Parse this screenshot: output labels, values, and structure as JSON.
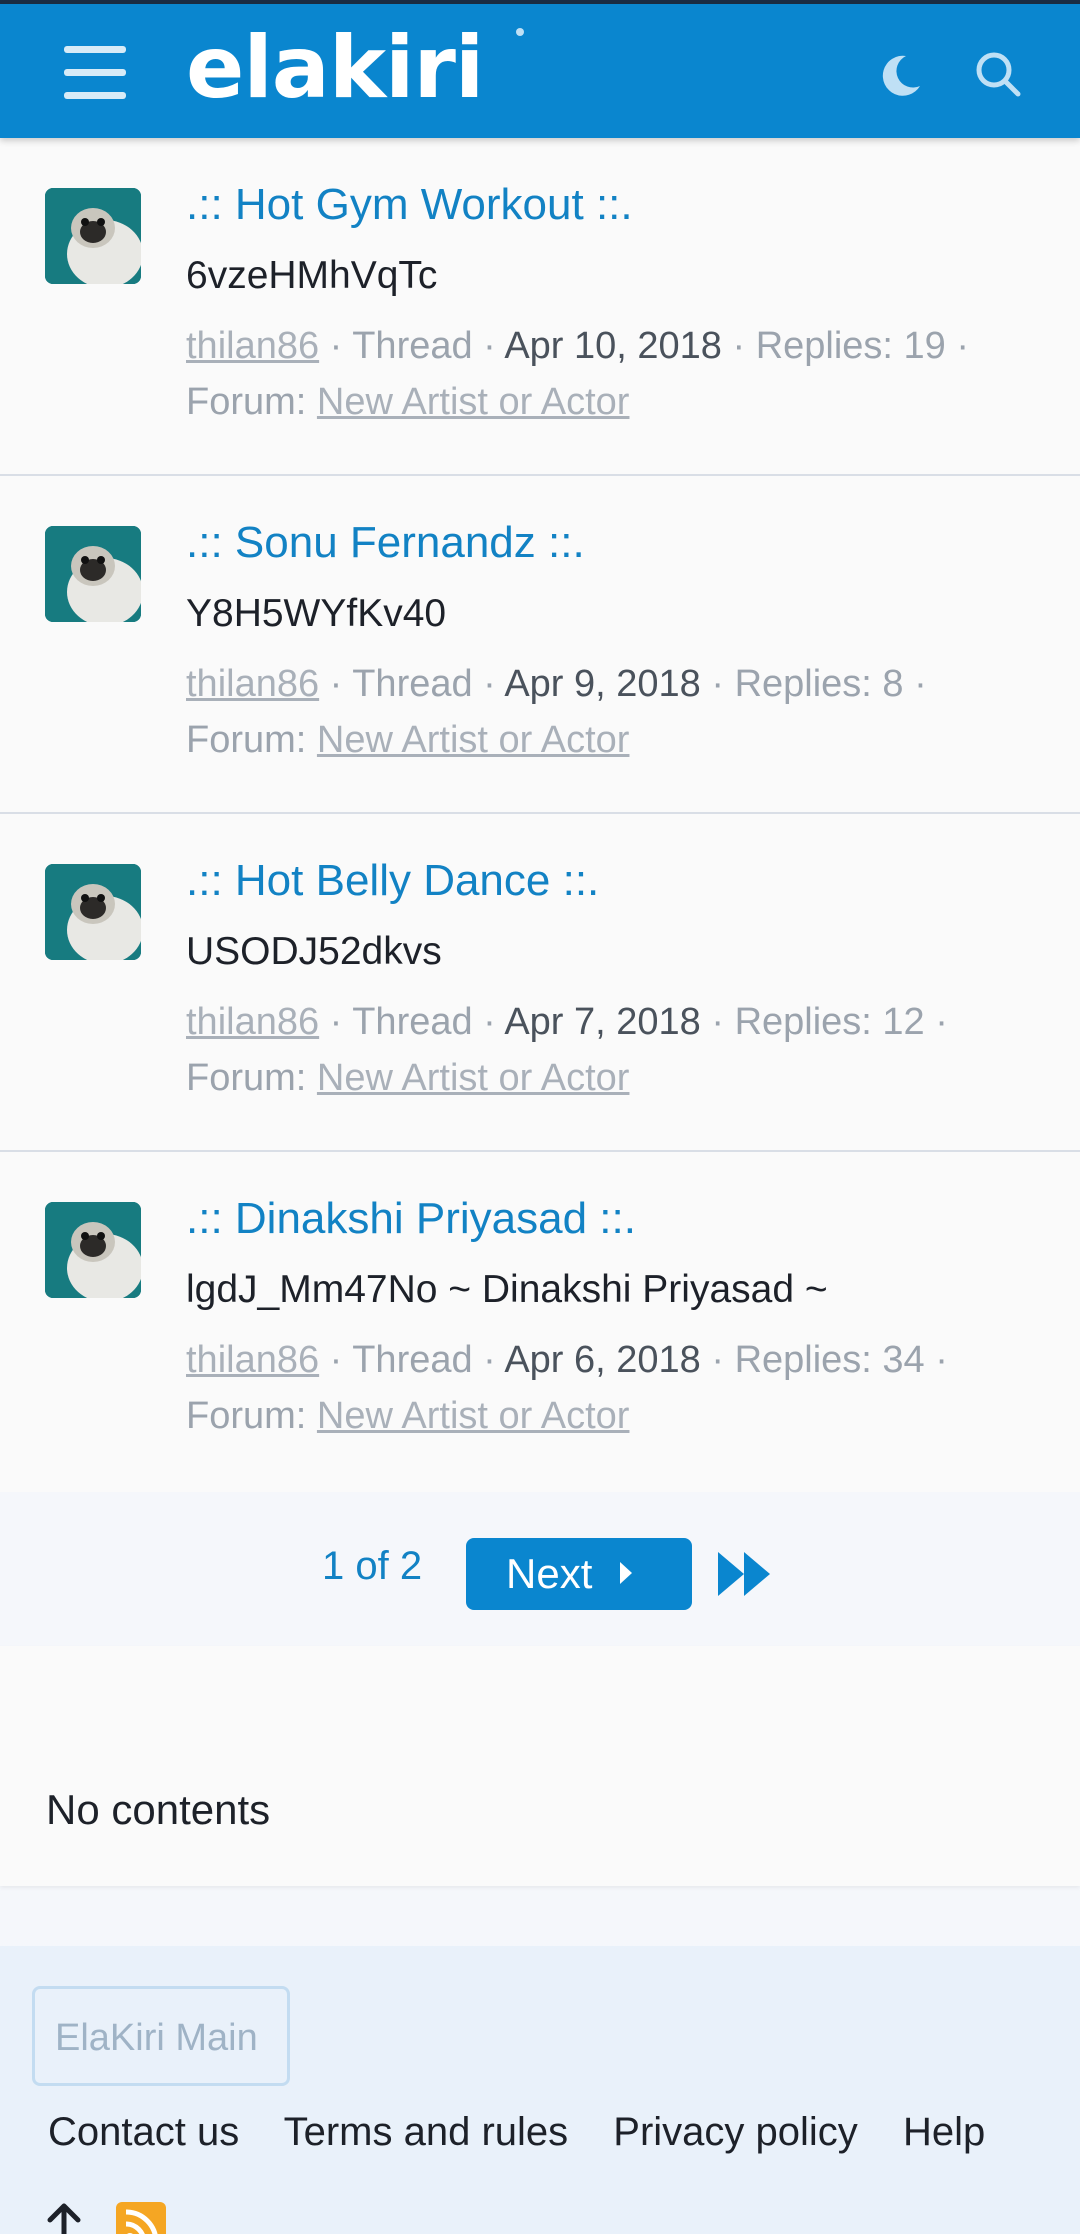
{
  "header": {
    "logo": "elakiri",
    "icons": [
      "hamburger-menu-icon",
      "moon-icon",
      "search-icon"
    ],
    "color": "#0a86cf"
  },
  "threads": [
    {
      "title": ".:: Hot Gym Workout ::.",
      "snippet": "6vzeHMhVqTc",
      "author": "thilan86",
      "type": "Thread",
      "date": "Apr 10, 2018",
      "replies": "Replies: 19",
      "forum_label": "Forum:",
      "forum": "New Artist or Actor"
    },
    {
      "title": ".:: Sonu Fernandz ::.",
      "snippet": "Y8H5WYfKv40",
      "author": "thilan86",
      "type": "Thread",
      "date": "Apr 9, 2018",
      "replies": "Replies: 8",
      "forum_label": "Forum:",
      "forum": "New Artist or Actor"
    },
    {
      "title": ".:: Hot Belly Dance ::.",
      "snippet": "USODJ52dkvs",
      "author": "thilan86",
      "type": "Thread",
      "date": "Apr 7, 2018",
      "replies": "Replies: 12",
      "forum_label": "Forum:",
      "forum": "New Artist or Actor"
    },
    {
      "title": ".:: Dinakshi Priyasad ::.",
      "snippet": "lgdJ_Mm47No ~ Dinakshi Priyasad ~",
      "author": "thilan86",
      "type": "Thread",
      "date": "Apr 6, 2018",
      "replies": "Replies: 34",
      "forum_label": "Forum:",
      "forum": "New Artist or Actor"
    }
  ],
  "pagination": {
    "current": "1 of 2",
    "next_label": "Next"
  },
  "empty_block": {
    "text": "No contents"
  },
  "footer": {
    "main_button": "ElaKiri Main",
    "links": [
      "Contact us",
      "Terms and rules",
      "Privacy policy",
      "Help"
    ],
    "icons": [
      "arrow-up-icon",
      "rss-icon"
    ]
  }
}
